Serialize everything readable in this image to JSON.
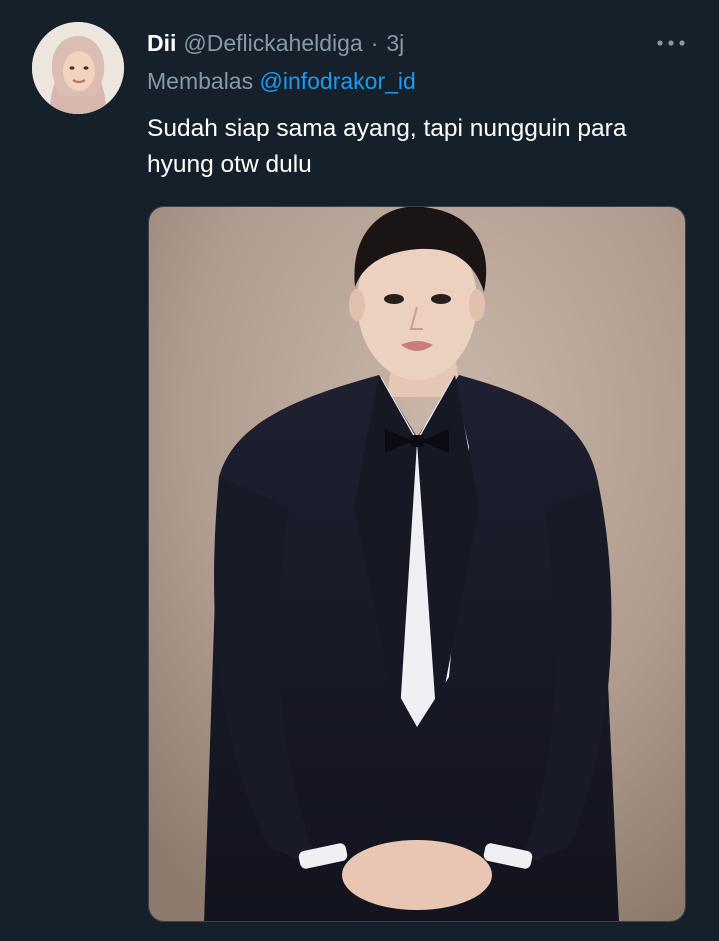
{
  "tweet": {
    "author": {
      "display_name": "Dii",
      "handle": "@Deflickaheldiga",
      "avatar_icon": "user-avatar"
    },
    "separator": "·",
    "timestamp": "3j",
    "more_icon": "more-horizontal-icon",
    "reply": {
      "prefix": "Membalas",
      "mention": "@infodrakor_id"
    },
    "text_lines": [
      "Sudah siap sama ayang, tapi nungguin para",
      "hyung otw dulu"
    ],
    "media": {
      "type": "photo"
    }
  },
  "colors": {
    "background": "#15202b",
    "primary_text": "#ffffff",
    "secondary_text": "#8899a6",
    "accent": "#1d9bf0",
    "border": "#38444d"
  }
}
